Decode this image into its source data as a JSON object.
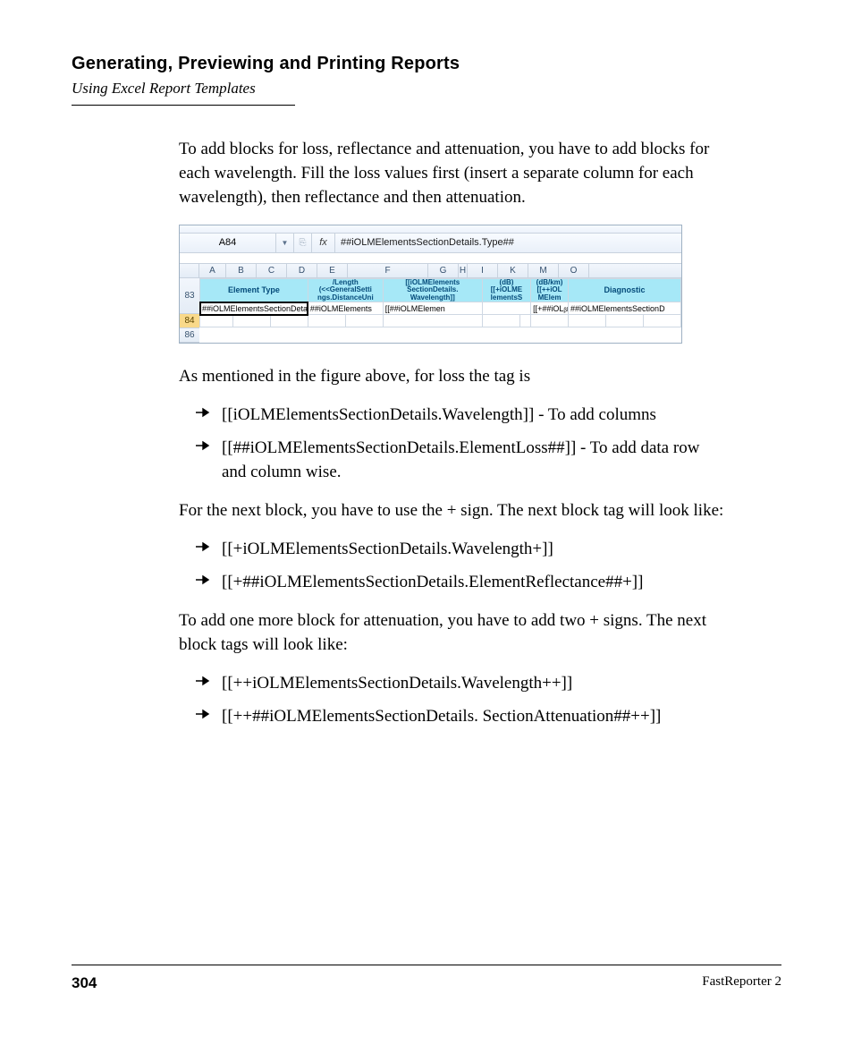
{
  "header": {
    "title": "Generating, Previewing and Printing Reports",
    "subtitle": "Using Excel Report Templates"
  },
  "body": {
    "p1": "To add blocks for loss, reflectance and attenuation, you have to add blocks for each wavelength. Fill the loss values first (insert a separate column for each wavelength), then reflectance and then attenuation.",
    "p2": "As mentioned in the figure above, for loss the tag is",
    "list1": [
      "[[iOLMElementsSectionDetails.Wavelength]] - To add columns",
      "[[##iOLMElementsSectionDetails.ElementLoss##]] - To add data row and column wise."
    ],
    "p3": "For the next block, you have to use the + sign. The next block tag will look like:",
    "list2": [
      "[[+iOLMElementsSectionDetails.Wavelength+]]",
      "[[+##iOLMElementsSectionDetails.ElementReflectance##+]]"
    ],
    "p4": "To add one more block for attenuation, you have to add two + signs. The next block tags will look like:",
    "list3": [
      "[[++iOLMElementsSectionDetails.Wavelength++]]",
      "[[++##iOLMElementsSectionDetails. SectionAttenuation##++]]"
    ]
  },
  "figure": {
    "namebox": "A84",
    "fx": "fx",
    "formula": "##iOLMElementsSectionDetails.Type##",
    "cols": [
      "A",
      "B",
      "C",
      "D",
      "E",
      "F",
      "G",
      "H",
      "I",
      "K",
      "M",
      "O"
    ],
    "rows": [
      "83",
      "84",
      "86"
    ],
    "row83": {
      "element_type": "Element Type",
      "length": "/Length (<<GeneralSetti ngs.DistanceUni",
      "wavelength": "[[iOLMElements SectionDetails. Wavelength]]",
      "db": "(dB) [[+iOLME lementsS",
      "dbkm": "(dB/km) [[++iOL MElem",
      "diagnostic": "Diagnostic"
    },
    "row84": {
      "A": "##iOLMElementsSectionDeta",
      "D": "##iOLMElements",
      "F": "[[##iOLMElemen",
      "I": "[[+##iOLᵦn##++]]",
      "K": "##iOLMElementsSectionD"
    }
  },
  "footer": {
    "page": "304",
    "doc": "FastReporter 2"
  }
}
